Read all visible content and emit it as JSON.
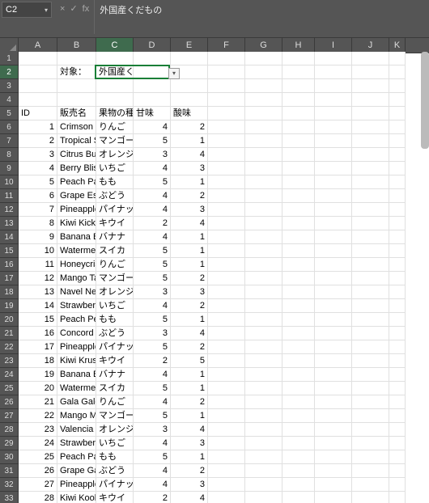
{
  "namebox": {
    "ref": "C2"
  },
  "fx": {
    "cancel": "×",
    "confirm": "✓",
    "fx": "fx"
  },
  "formula_bar": {
    "value": "外国産くだもの"
  },
  "columns": [
    "A",
    "B",
    "C",
    "D",
    "E",
    "F",
    "G",
    "H",
    "I",
    "J",
    "K"
  ],
  "selected_col": "C",
  "selected_row": 2,
  "selected_cell_value": "外国産くだもの",
  "labels": {
    "target": "対象：",
    "dropdown_chev": "▾"
  },
  "headers": {
    "id": "ID",
    "name": "販売名",
    "kind": "果物の種類",
    "sweet": "甘味",
    "sour": "酸味"
  },
  "rows": [
    {
      "id": 1,
      "name": "Crimson D",
      "kind": "りんご",
      "sweet": 4,
      "sour": 2
    },
    {
      "id": 2,
      "name": "Tropical S",
      "kind": "マンゴー",
      "sweet": 5,
      "sour": 1
    },
    {
      "id": 3,
      "name": "Citrus Bur",
      "kind": "オレンジ",
      "sweet": 3,
      "sour": 4
    },
    {
      "id": 4,
      "name": "Berry Bliss",
      "kind": "いちご",
      "sweet": 4,
      "sour": 3
    },
    {
      "id": 5,
      "name": "Peach Par",
      "kind": "もも",
      "sweet": 5,
      "sour": 1
    },
    {
      "id": 6,
      "name": "Grape Esc",
      "kind": "ぶどう",
      "sweet": 4,
      "sour": 2
    },
    {
      "id": 7,
      "name": "Pineapple",
      "kind": "パイナッ",
      "sweet": 4,
      "sour": 3
    },
    {
      "id": 8,
      "name": "Kiwi Kick",
      "kind": "キウイ",
      "sweet": 2,
      "sour": 4
    },
    {
      "id": 9,
      "name": "Banana Bo",
      "kind": "バナナ",
      "sweet": 4,
      "sour": 1
    },
    {
      "id": 10,
      "name": "Watermelo",
      "kind": "スイカ",
      "sweet": 5,
      "sour": 1
    },
    {
      "id": 11,
      "name": "Honeycris",
      "kind": "りんご",
      "sweet": 5,
      "sour": 1
    },
    {
      "id": 12,
      "name": "Mango Ta",
      "kind": "マンゴー",
      "sweet": 5,
      "sour": 2
    },
    {
      "id": 13,
      "name": "Navel Nec",
      "kind": "オレンジ",
      "sweet": 3,
      "sour": 3
    },
    {
      "id": 14,
      "name": "Strawberr",
      "kind": "いちご",
      "sweet": 4,
      "sour": 2
    },
    {
      "id": 15,
      "name": "Peach Per",
      "kind": "もも",
      "sweet": 5,
      "sour": 1
    },
    {
      "id": 16,
      "name": "Concord C",
      "kind": "ぶどう",
      "sweet": 3,
      "sour": 4
    },
    {
      "id": 17,
      "name": "Pineapple",
      "kind": "パイナッ",
      "sweet": 5,
      "sour": 2
    },
    {
      "id": 18,
      "name": "Kiwi Krus",
      "kind": "キウイ",
      "sweet": 2,
      "sour": 5
    },
    {
      "id": 19,
      "name": "Banana Bl",
      "kind": "バナナ",
      "sweet": 4,
      "sour": 1
    },
    {
      "id": 20,
      "name": "Watermelo",
      "kind": "スイカ",
      "sweet": 5,
      "sour": 1
    },
    {
      "id": 21,
      "name": "Gala Galo",
      "kind": "りんご",
      "sweet": 4,
      "sour": 2
    },
    {
      "id": 22,
      "name": "Mango Ma",
      "kind": "マンゴー",
      "sweet": 5,
      "sour": 1
    },
    {
      "id": 23,
      "name": "Valencia V",
      "kind": "オレンジ",
      "sweet": 3,
      "sour": 4
    },
    {
      "id": 24,
      "name": "Strawberr",
      "kind": "いちご",
      "sweet": 4,
      "sour": 3
    },
    {
      "id": 25,
      "name": "Peach Pas",
      "kind": "もも",
      "sweet": 5,
      "sour": 1
    },
    {
      "id": 26,
      "name": "Grape Gal",
      "kind": "ぶどう",
      "sweet": 4,
      "sour": 2
    },
    {
      "id": 27,
      "name": "Pineapple",
      "kind": "パイナッ",
      "sweet": 4,
      "sour": 3
    },
    {
      "id": 28,
      "name": "Kiwi Kool",
      "kind": "キウイ",
      "sweet": 2,
      "sour": 4
    }
  ]
}
